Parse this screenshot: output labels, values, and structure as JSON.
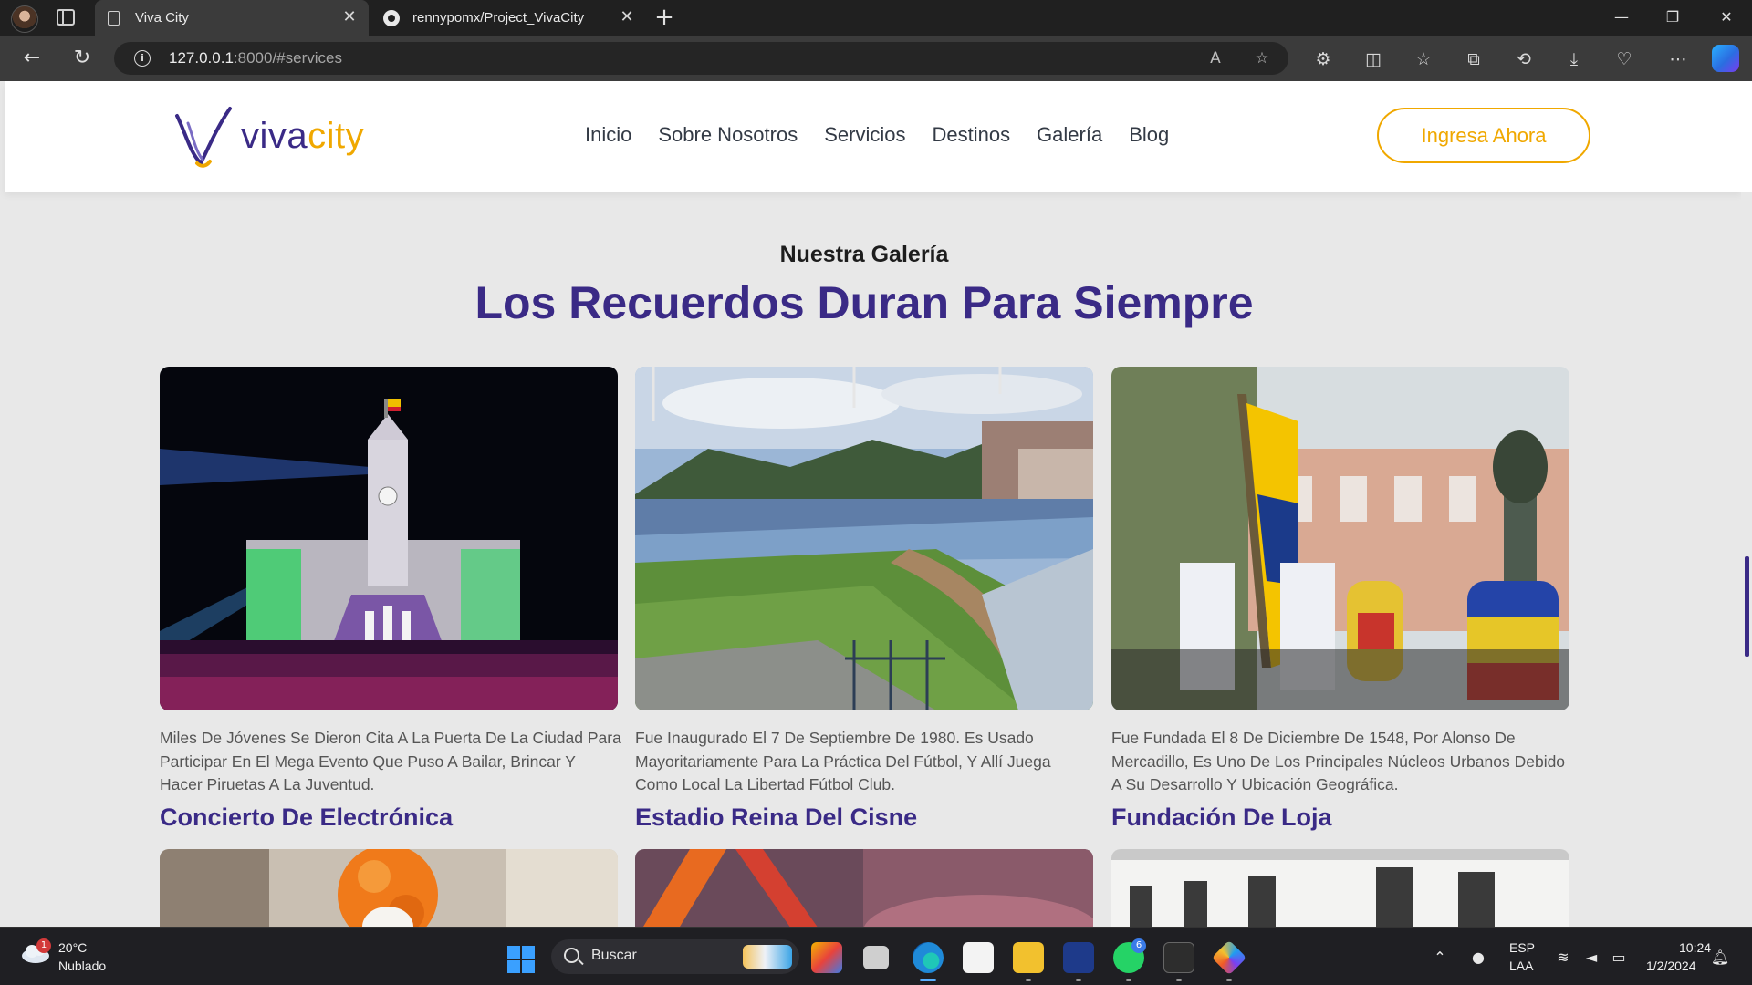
{
  "browser": {
    "tabs": [
      {
        "title": "Viva City",
        "active": true
      },
      {
        "title": "rennypomx/Project_VivaCity",
        "active": false
      }
    ],
    "url_host": "127.0.0.1",
    "url_rest": ":8000/#services"
  },
  "site": {
    "logo_part1": "viva",
    "logo_part2": "city",
    "nav": [
      "Inicio",
      "Sobre Nosotros",
      "Servicios",
      "Destinos",
      "Galería",
      "Blog"
    ],
    "cta": "Ingresa Ahora"
  },
  "gallery": {
    "subtitle": "Nuestra Galería",
    "title": "Los Recuerdos Duran Para Siempre",
    "cards": [
      {
        "description": "Miles De Jóvenes Se Dieron Cita A La Puerta De La Ciudad Para Participar En El Mega Evento Que Puso A Bailar, Brincar Y Hacer Piruetas A La Juventud.",
        "title": "Concierto De Electrónica"
      },
      {
        "description": "Fue Inaugurado El 7 De Septiembre De 1980. Es Usado Mayoritariamente Para La Práctica Del Fútbol, Y Allí Juega Como Local La Libertad Fútbol Club.",
        "title": "Estadio Reina Del Cisne"
      },
      {
        "description": "Fue Fundada El 8 De Diciembre De 1548, Por Alonso De Mercadillo, Es Uno De Los Principales Núcleos Urbanos Debido A Su Desarrollo Y Ubicación Geográfica.",
        "title": "Fundación De Loja"
      }
    ]
  },
  "taskbar": {
    "weather_temp": "20°C",
    "weather_desc": "Nublado",
    "weather_badge": "1",
    "search_placeholder": "Buscar",
    "whatsapp_badge": "6",
    "lang_code": "ESP",
    "lang_layout": "LAA",
    "time": "10:24",
    "date": "1/2/2024"
  },
  "colors": {
    "brand_purple": "#3a2a86",
    "brand_yellow": "#f0a800"
  }
}
